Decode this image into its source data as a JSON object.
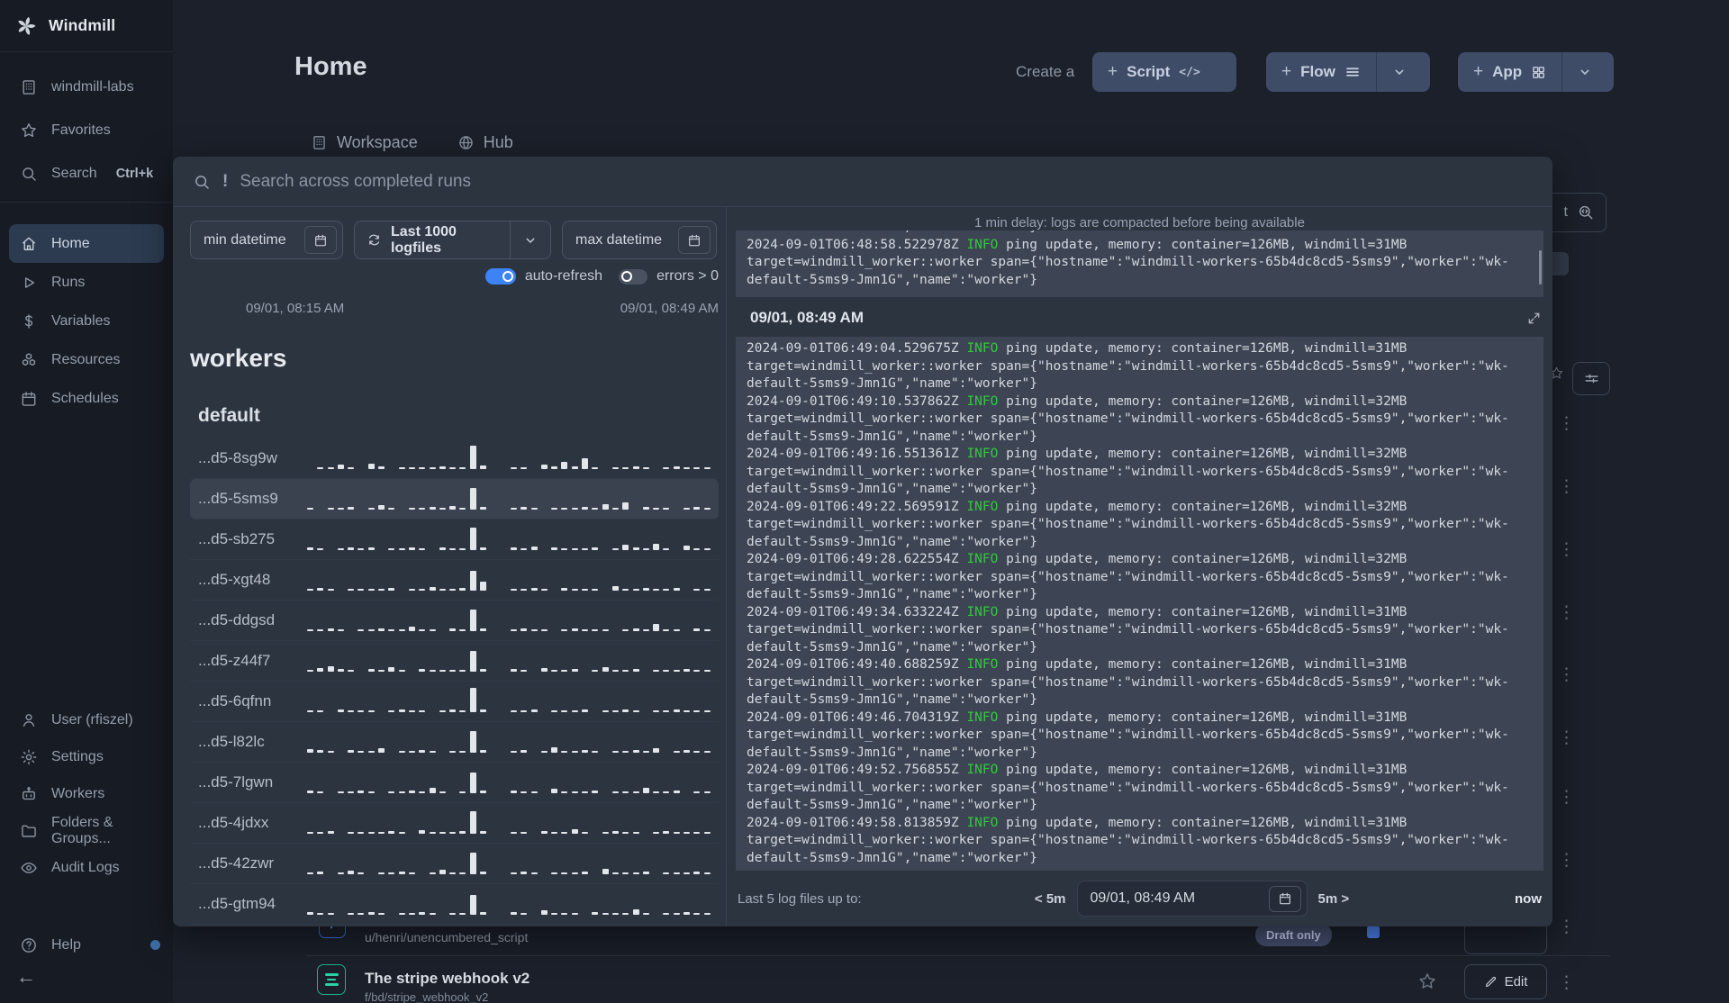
{
  "sidebar": {
    "brand": "Windmill",
    "top_items": [
      {
        "label": "windmill-labs",
        "icon": "building"
      },
      {
        "label": "Favorites",
        "icon": "star"
      },
      {
        "label": "Search",
        "icon": "search",
        "shortcut": "Ctrl+k"
      }
    ],
    "menu_items": [
      {
        "label": "Home",
        "icon": "home",
        "active": true
      },
      {
        "label": "Runs",
        "icon": "play"
      },
      {
        "label": "Variables",
        "icon": "dollar"
      },
      {
        "label": "Resources",
        "icon": "resources"
      },
      {
        "label": "Schedules",
        "icon": "calendar"
      }
    ],
    "bottom_items": [
      {
        "label": "User (rfiszel)",
        "icon": "user"
      },
      {
        "label": "Settings",
        "icon": "gear"
      },
      {
        "label": "Workers",
        "icon": "robot"
      },
      {
        "label": "Folders & Groups...",
        "icon": "folder"
      },
      {
        "label": "Audit Logs",
        "icon": "eye"
      }
    ],
    "help_item": {
      "label": "Help",
      "icon": "help",
      "dot": true
    }
  },
  "header": {
    "title": "Home",
    "create_label": "Create a",
    "script_label": "Script",
    "flow_label": "Flow",
    "app_label": "App"
  },
  "tabs": {
    "workspace": "Workspace",
    "hub": "Hub"
  },
  "background": {
    "search_tail": "t",
    "rows": [
      {
        "path": "u/henri/unencumbered_script",
        "badge": "Draft only"
      },
      {
        "title": "The stripe webhook v2",
        "path": "f/bd/stripe_webhook_v2",
        "edit_label": "Edit"
      }
    ]
  },
  "overlay": {
    "search_placeholder": "Search across completed runs",
    "filters": {
      "min_datetime": "min datetime",
      "logfiles": "Last 1000 logfiles",
      "max_datetime": "max datetime",
      "auto_refresh": "auto-refresh",
      "errors": "errors > 0"
    },
    "time_range": {
      "start": "09/01, 08:15 AM",
      "end": "09/01, 08:49 AM"
    },
    "workers_heading": "workers",
    "group_heading": "default",
    "workers": [
      {
        "name": "...d5-8sg9w",
        "bars": [
          0,
          2,
          2,
          5,
          2,
          0,
          6,
          3,
          0,
          2,
          2,
          2,
          2,
          3,
          2,
          2,
          26,
          4,
          0,
          0,
          2,
          2,
          0,
          5,
          3,
          8,
          3,
          12,
          2,
          0,
          2,
          2,
          3,
          2,
          0,
          2,
          3,
          2,
          2,
          2
        ]
      },
      {
        "name": "...d5-5sms9",
        "selected": true,
        "bars": [
          2,
          0,
          2,
          2,
          3,
          0,
          2,
          5,
          2,
          0,
          2,
          2,
          3,
          2,
          4,
          2,
          24,
          3,
          0,
          0,
          2,
          3,
          2,
          0,
          2,
          2,
          2,
          3,
          2,
          6,
          2,
          8,
          0,
          3,
          2,
          2,
          0,
          2,
          3,
          2
        ]
      },
      {
        "name": "...d5-sb275",
        "bars": [
          3,
          2,
          0,
          2,
          3,
          2,
          3,
          0,
          2,
          2,
          3,
          2,
          0,
          3,
          2,
          2,
          25,
          3,
          0,
          0,
          3,
          2,
          4,
          0,
          3,
          2,
          2,
          2,
          3,
          0,
          2,
          6,
          3,
          2,
          7,
          2,
          0,
          5,
          2,
          2
        ]
      },
      {
        "name": "...d5-xgt48",
        "bars": [
          2,
          3,
          2,
          0,
          2,
          2,
          2,
          2,
          3,
          0,
          2,
          2,
          4,
          2,
          2,
          3,
          22,
          10,
          0,
          0,
          2,
          2,
          3,
          2,
          0,
          3,
          2,
          2,
          2,
          0,
          5,
          2,
          2,
          3,
          2,
          2,
          3,
          0,
          2,
          2
        ]
      },
      {
        "name": "...d5-ddgsd",
        "bars": [
          2,
          2,
          3,
          2,
          0,
          2,
          2,
          3,
          2,
          2,
          5,
          2,
          2,
          0,
          3,
          2,
          24,
          3,
          0,
          0,
          2,
          3,
          2,
          2,
          0,
          2,
          3,
          2,
          2,
          2,
          0,
          2,
          3,
          2,
          8,
          2,
          2,
          0,
          3,
          2
        ]
      },
      {
        "name": "...d5-z44f7",
        "bars": [
          2,
          4,
          6,
          3,
          2,
          0,
          3,
          2,
          5,
          2,
          0,
          3,
          2,
          2,
          2,
          2,
          23,
          3,
          0,
          0,
          3,
          2,
          0,
          4,
          2,
          2,
          3,
          0,
          2,
          5,
          2,
          2,
          3,
          0,
          2,
          2,
          2,
          3,
          2,
          2
        ]
      },
      {
        "name": "...d5-6qfnn",
        "bars": [
          2,
          2,
          0,
          3,
          2,
          2,
          2,
          0,
          2,
          3,
          2,
          2,
          0,
          2,
          3,
          2,
          27,
          3,
          0,
          0,
          2,
          2,
          3,
          0,
          2,
          2,
          2,
          3,
          0,
          2,
          2,
          3,
          2,
          0,
          2,
          2,
          3,
          2,
          2,
          2
        ]
      },
      {
        "name": "...d5-l82lc",
        "bars": [
          4,
          3,
          2,
          0,
          3,
          2,
          2,
          5,
          0,
          2,
          2,
          3,
          2,
          0,
          2,
          2,
          24,
          3,
          0,
          0,
          2,
          3,
          0,
          2,
          6,
          2,
          2,
          3,
          2,
          0,
          2,
          2,
          3,
          2,
          5,
          0,
          2,
          3,
          2,
          2
        ]
      },
      {
        "name": "...d5-7lgwn",
        "bars": [
          3,
          2,
          0,
          2,
          2,
          3,
          2,
          0,
          2,
          2,
          3,
          2,
          6,
          2,
          0,
          2,
          23,
          3,
          0,
          0,
          3,
          2,
          2,
          0,
          5,
          2,
          2,
          2,
          3,
          0,
          2,
          2,
          2,
          6,
          2,
          2,
          3,
          0,
          2,
          2
        ]
      },
      {
        "name": "...d5-4jdxx",
        "bars": [
          2,
          2,
          3,
          0,
          2,
          2,
          2,
          2,
          3,
          2,
          0,
          4,
          2,
          2,
          2,
          3,
          25,
          3,
          0,
          0,
          2,
          2,
          0,
          3,
          2,
          2,
          5,
          2,
          0,
          2,
          3,
          2,
          2,
          0,
          2,
          3,
          2,
          2,
          2,
          2
        ]
      },
      {
        "name": "...d5-42zwr",
        "bars": [
          2,
          3,
          0,
          2,
          4,
          2,
          0,
          2,
          2,
          3,
          2,
          0,
          2,
          5,
          2,
          2,
          24,
          3,
          0,
          0,
          2,
          3,
          2,
          0,
          2,
          2,
          2,
          3,
          0,
          6,
          2,
          2,
          2,
          3,
          0,
          2,
          2,
          2,
          3,
          2
        ]
      },
      {
        "name": "...d5-gtm94",
        "bars": [
          3,
          2,
          2,
          0,
          2,
          2,
          3,
          2,
          0,
          2,
          2,
          3,
          2,
          0,
          2,
          2,
          22,
          3,
          0,
          0,
          3,
          2,
          0,
          5,
          2,
          2,
          2,
          0,
          3,
          2,
          2,
          2,
          6,
          2,
          0,
          2,
          2,
          3,
          2,
          2
        ]
      }
    ],
    "log": {
      "delay_note": "1 min delay: logs are compacted before being available",
      "section_time": "09/01, 08:49 AM",
      "meta_lines": [
        "target=windmill_worker::worker span={\"hostname\":\"windmill-workers-65b4dc8cd5-5sms9\",\"worker\":\"wk-",
        "default-5sms9-Jmn1G\",\"name\":\"worker\"}"
      ],
      "prev_tail": "default-5sms9-Jmn1G\",\"name\":\"worker\"}",
      "prev_entries": [
        {
          "ts": "2024-09-01T06:48:58.522978Z",
          "level": "INFO",
          "msg": "ping update, memory: container=126MB, windmill=31MB"
        }
      ],
      "entries": [
        {
          "ts": "2024-09-01T06:49:04.529675Z",
          "level": "INFO",
          "msg": "ping update, memory: container=126MB, windmill=31MB"
        },
        {
          "ts": "2024-09-01T06:49:10.537862Z",
          "level": "INFO",
          "msg": "ping update, memory: container=126MB, windmill=32MB"
        },
        {
          "ts": "2024-09-01T06:49:16.551361Z",
          "level": "INFO",
          "msg": "ping update, memory: container=126MB, windmill=32MB"
        },
        {
          "ts": "2024-09-01T06:49:22.569591Z",
          "level": "INFO",
          "msg": "ping update, memory: container=126MB, windmill=32MB"
        },
        {
          "ts": "2024-09-01T06:49:28.622554Z",
          "level": "INFO",
          "msg": "ping update, memory: container=126MB, windmill=32MB"
        },
        {
          "ts": "2024-09-01T06:49:34.633224Z",
          "level": "INFO",
          "msg": "ping update, memory: container=126MB, windmill=31MB"
        },
        {
          "ts": "2024-09-01T06:49:40.688259Z",
          "level": "INFO",
          "msg": "ping update, memory: container=126MB, windmill=31MB"
        },
        {
          "ts": "2024-09-01T06:49:46.704319Z",
          "level": "INFO",
          "msg": "ping update, memory: container=126MB, windmill=31MB"
        },
        {
          "ts": "2024-09-01T06:49:52.756855Z",
          "level": "INFO",
          "msg": "ping update, memory: container=126MB, windmill=31MB"
        },
        {
          "ts": "2024-09-01T06:49:58.813859Z",
          "level": "INFO",
          "msg": "ping update, memory: container=126MB, windmill=31MB"
        }
      ],
      "footer": {
        "label": "Last 5 log files up to:",
        "back": "< 5m",
        "datetime": "09/01, 08:49 AM",
        "forward": "5m >",
        "now": "now"
      }
    }
  }
}
